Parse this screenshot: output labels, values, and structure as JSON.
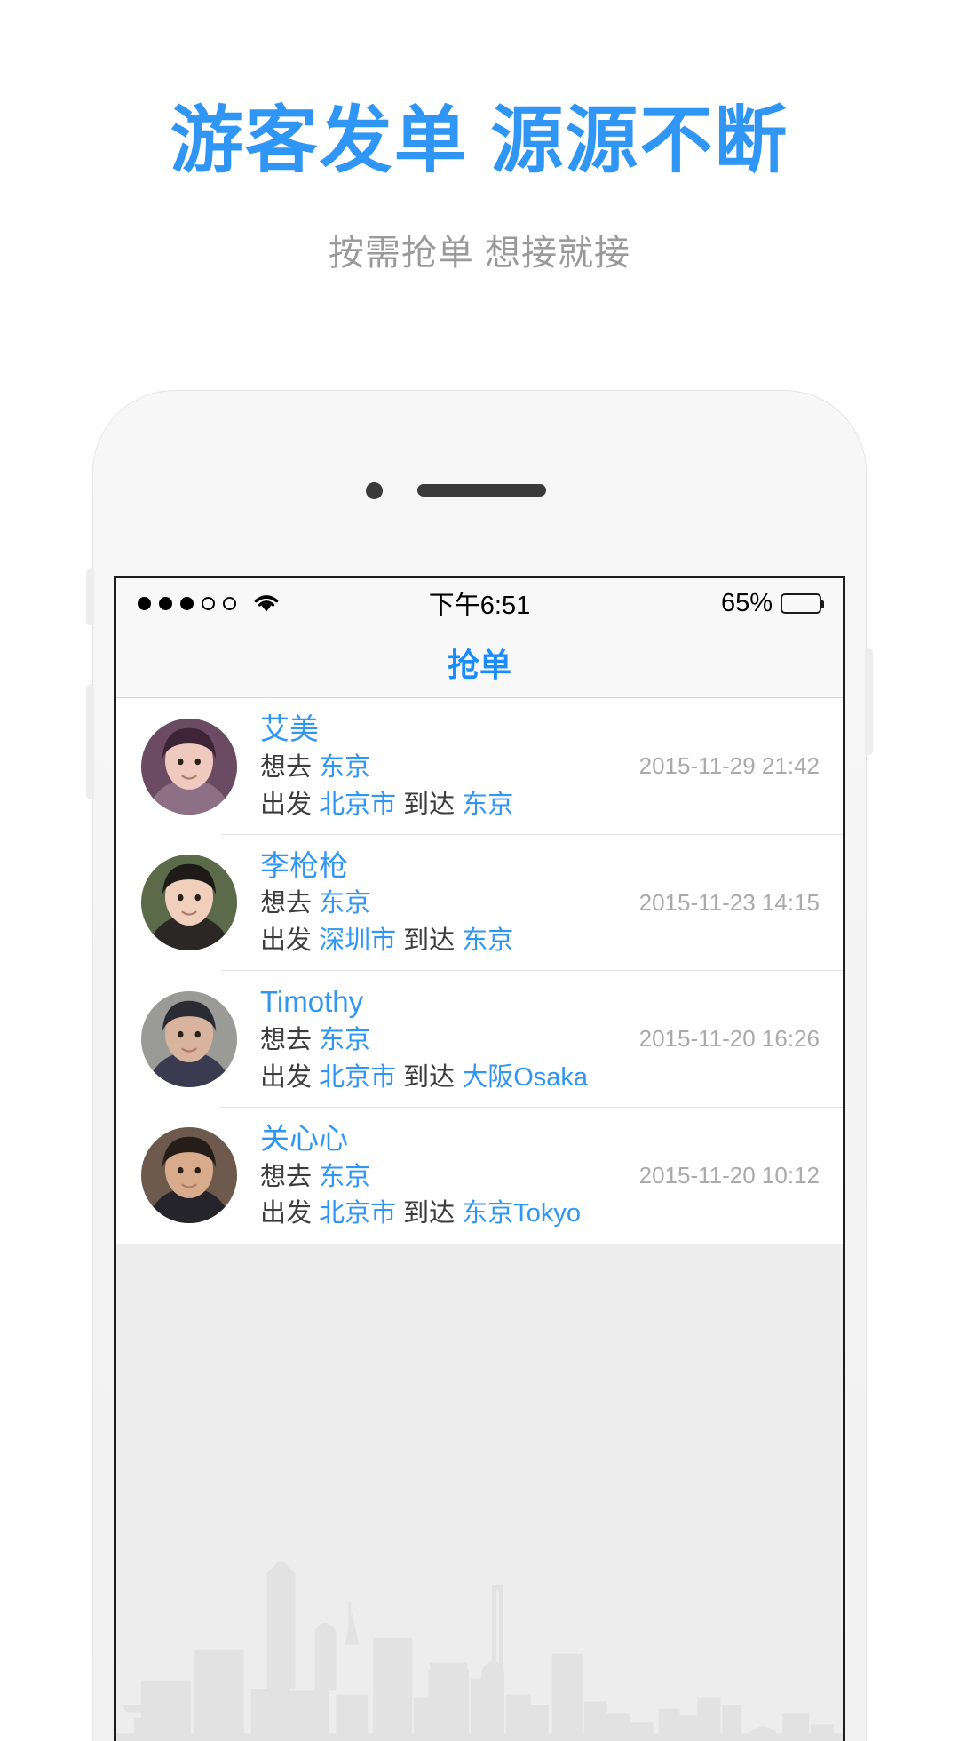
{
  "promo": {
    "title": "游客发单 源源不断",
    "subtitle": "按需抢单 想接就接",
    "title_color": "#2f96f6",
    "subtitle_color": "#9a9a9a"
  },
  "phone": {
    "status_bar": {
      "signal_dots_filled": 3,
      "signal_dots_total": 5,
      "wifi_icon": "wifi-icon",
      "time": "下午6:51",
      "battery_percent": "65%",
      "battery_level": 65
    },
    "nav": {
      "title": "抢单",
      "title_color": "#1a8cff"
    },
    "list": {
      "labels": {
        "want": "想去",
        "depart": "出发",
        "arrive": "到达"
      },
      "rows": [
        {
          "name": "艾美",
          "want_to": "东京",
          "from": "北京市",
          "to": "东京",
          "time": "2015-11-29 21:42",
          "avatar": "female-purple-hair"
        },
        {
          "name": "李枪枪",
          "want_to": "东京",
          "from": "深圳市",
          "to": "东京",
          "time": "2015-11-23 14:15",
          "avatar": "female-black-hat"
        },
        {
          "name": "Timothy",
          "want_to": "东京",
          "from": "北京市",
          "to": "大阪Osaka",
          "time": "2015-11-20 16:26",
          "avatar": "male-standing-outdoor"
        },
        {
          "name": "关心心",
          "want_to": "东京",
          "from": "北京市",
          "to": "东京Tokyo",
          "time": "2015-11-20 10:12",
          "avatar": "male-profile"
        }
      ]
    },
    "empty_area": {
      "watermark": "city-skyline-watermark"
    }
  }
}
